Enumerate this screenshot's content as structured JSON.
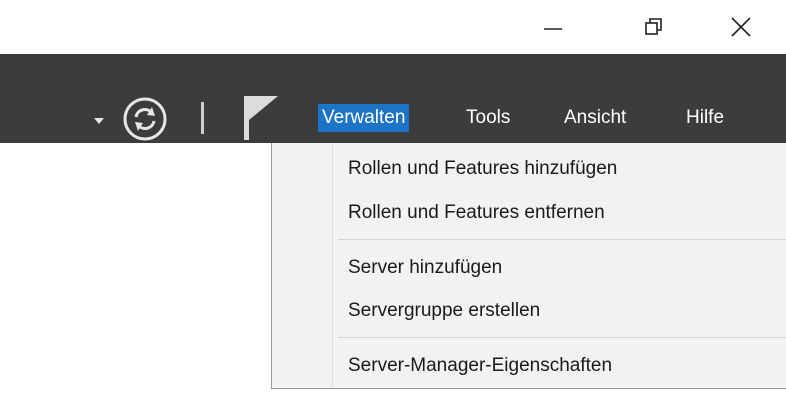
{
  "window_controls": {
    "minimize_icon": "minimize-icon",
    "maximize_icon": "restore-icon",
    "close_icon": "close-icon"
  },
  "toolbar": {
    "background": "#3c3c3c",
    "icons": [
      "dropdown-arrow-icon",
      "refresh-icon",
      "separator",
      "notification-flag-icon"
    ]
  },
  "menu": {
    "items": [
      {
        "label": "Verwalten",
        "active": true
      },
      {
        "label": "Tools",
        "active": false
      },
      {
        "label": "Ansicht",
        "active": false
      },
      {
        "label": "Hilfe",
        "active": false
      }
    ],
    "active_color": "#1d74c7"
  },
  "dropdown": {
    "groups": [
      [
        "Rollen und Features hinzufügen",
        "Rollen und Features entfernen"
      ],
      [
        "Server hinzufügen",
        "Servergruppe erstellen"
      ],
      [
        "Server-Manager-Eigenschaften"
      ]
    ]
  }
}
